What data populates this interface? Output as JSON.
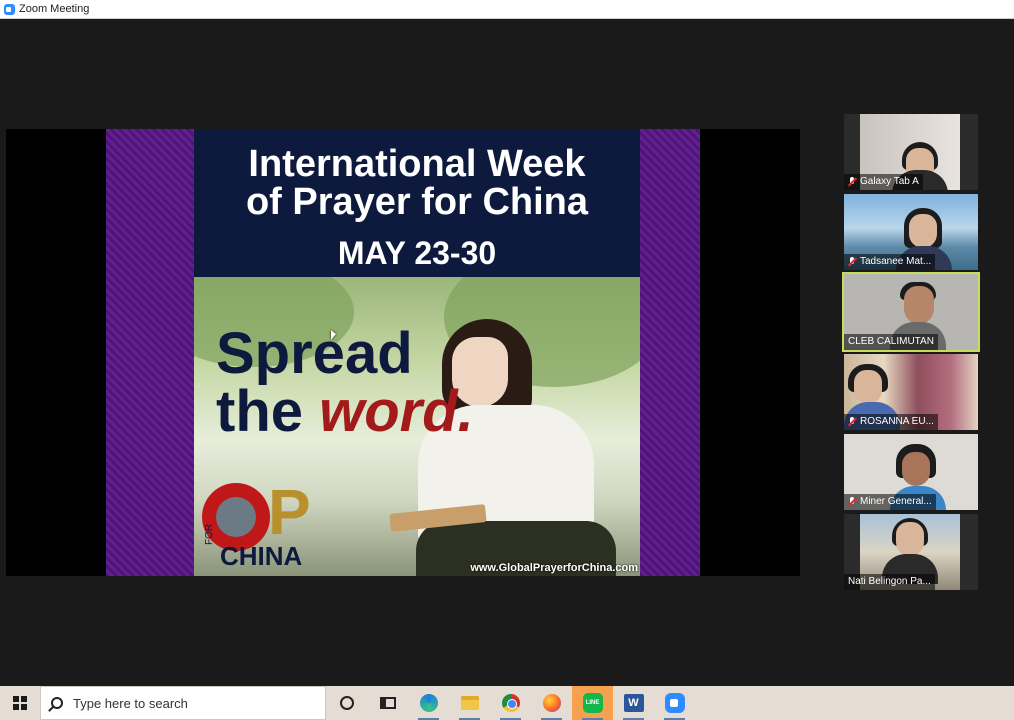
{
  "window": {
    "title": "Zoom Meeting"
  },
  "shared_screen": {
    "poster": {
      "title_line1": "International Week",
      "title_line2": "of Prayer for China",
      "date": "MAY 23-30",
      "slogan_line1": "Spread",
      "slogan_line2_a": "the ",
      "slogan_line2_b": "word.",
      "logo_letter_p": "P",
      "logo_for": "FOR",
      "logo_china": "CHINA",
      "website": "www.GlobalPrayerforChina.com"
    }
  },
  "participants": [
    {
      "name": "Galaxy Tab A",
      "muted": true
    },
    {
      "name": "Tadsanee Mat...",
      "muted": true
    },
    {
      "name": "CLEB CALIMUTAN",
      "muted": false,
      "speaking": true
    },
    {
      "name": "ROSANNA EU...",
      "muted": true
    },
    {
      "name": "Miner General...",
      "muted": true
    },
    {
      "name": "Nati Belingon Pa...",
      "muted": false
    }
  ],
  "taskbar": {
    "search_placeholder": "Type here to search",
    "apps": [
      "cortana-icon",
      "task-view-icon",
      "edge-icon",
      "file-explorer-icon",
      "chrome-icon",
      "firefox-icon",
      "line-icon",
      "word-icon",
      "zoom-icon"
    ],
    "line_label": "LINE",
    "word_label": "W",
    "active_app": "line-icon"
  },
  "colors": {
    "accent_speaking": "#c5dd5e",
    "taskbar": "#e5dcd3",
    "active_app": "#f5a14f"
  }
}
